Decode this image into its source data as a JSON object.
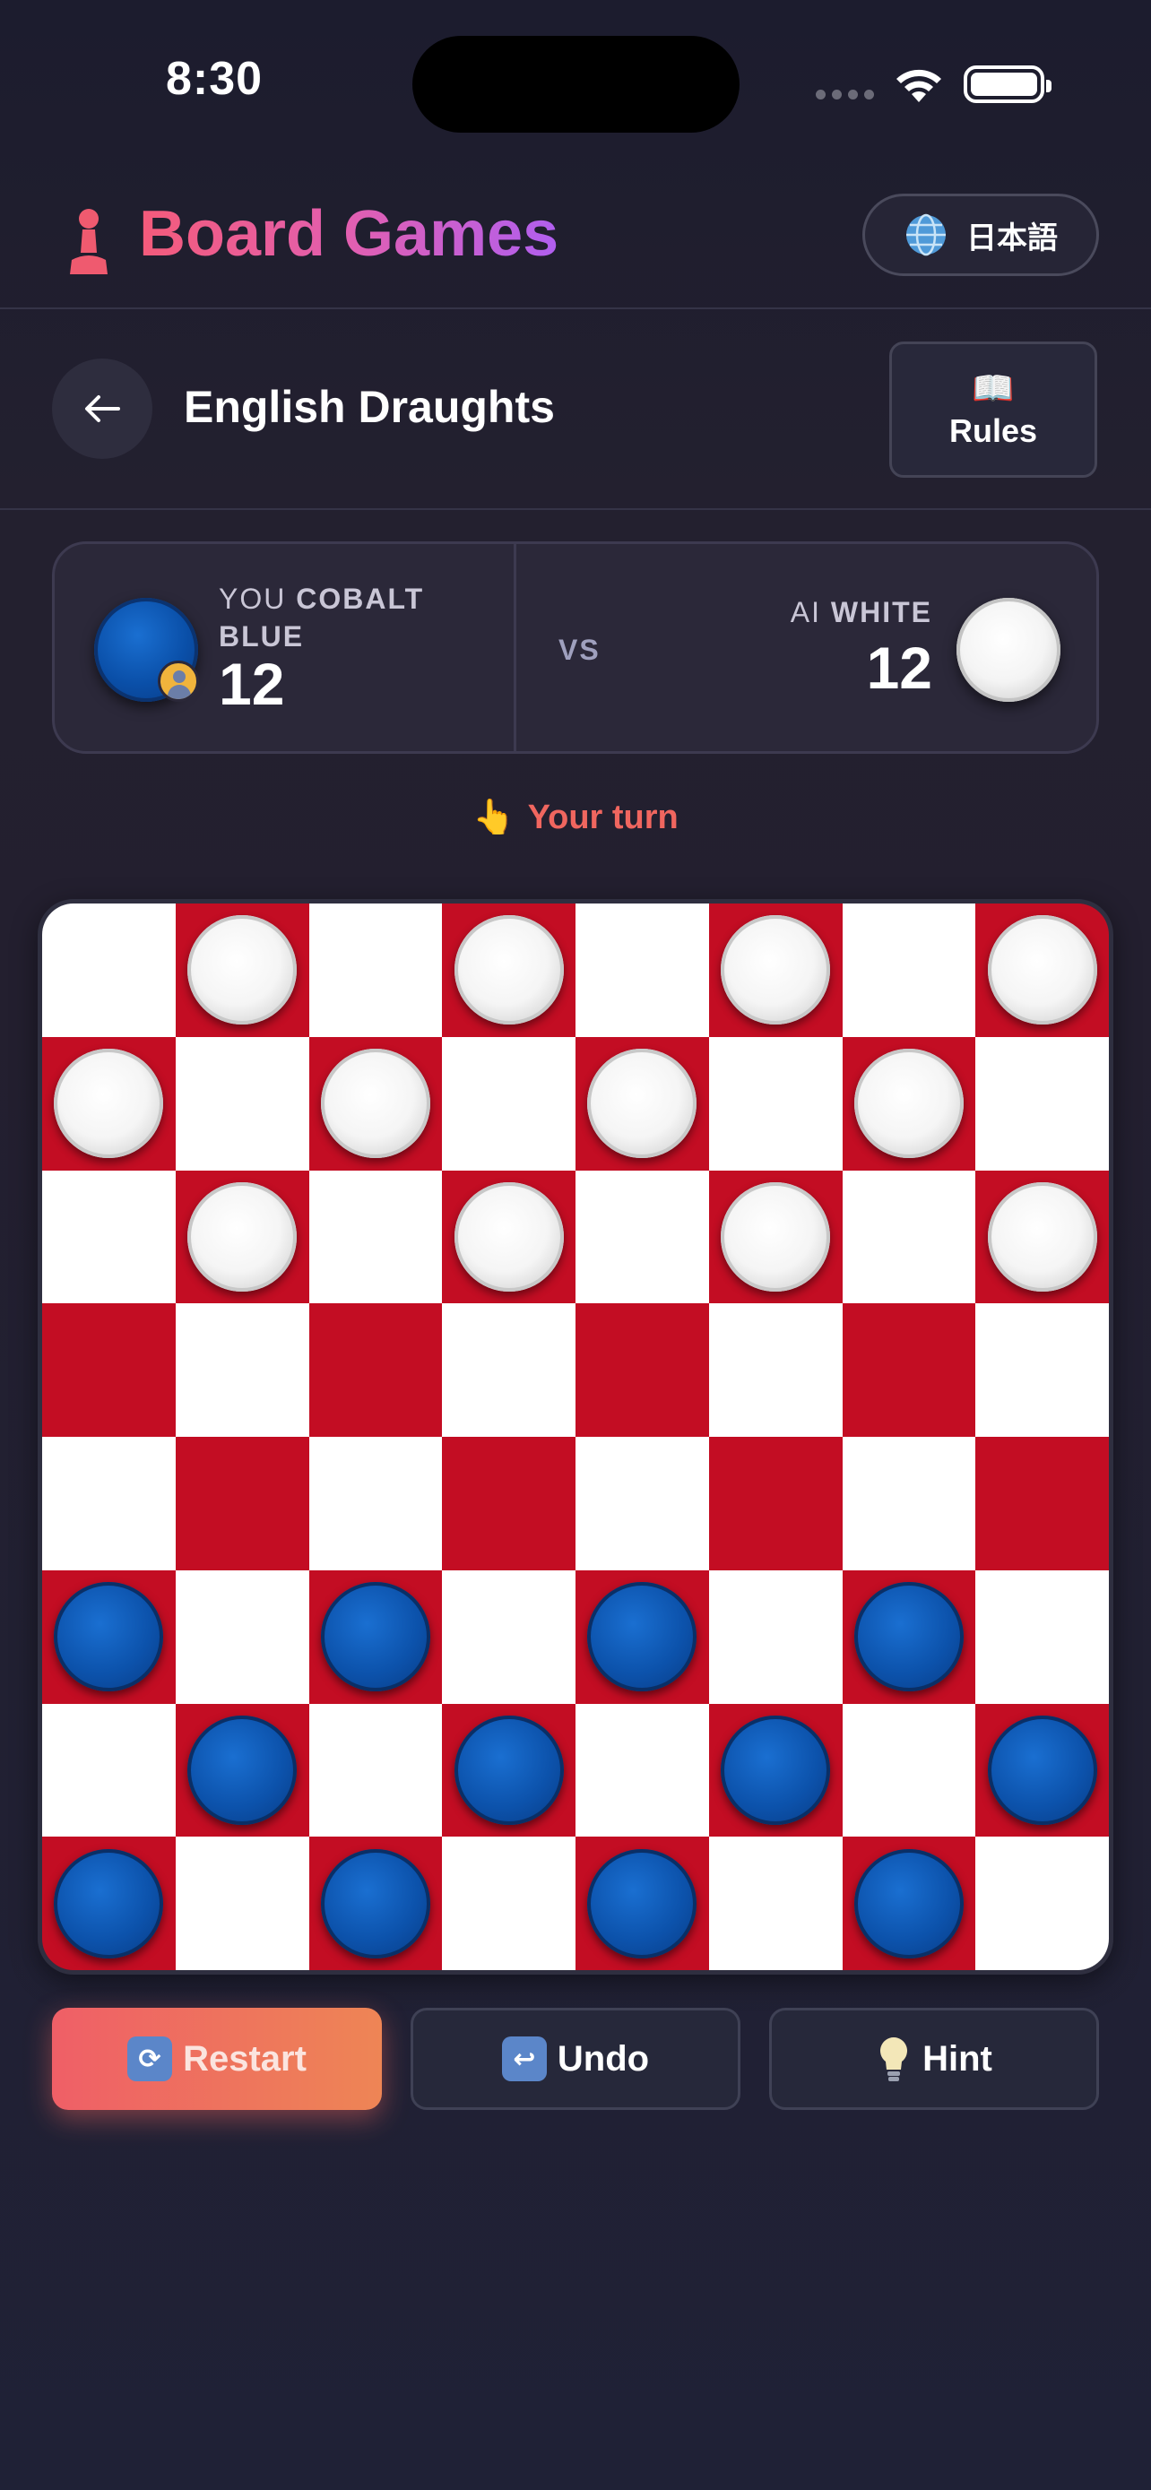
{
  "status_bar": {
    "time": "8:30"
  },
  "header": {
    "app_title": "Board Games",
    "language_button": "日本語"
  },
  "game": {
    "title": "English Draughts",
    "rules_label": "Rules"
  },
  "players": {
    "you": {
      "role": "YOU",
      "color_name": "COBALT BLUE",
      "pieces": "12"
    },
    "vs_label": "VS",
    "ai": {
      "role": "AI",
      "color_name": "WHITE",
      "pieces": "12"
    }
  },
  "turn_text": "Your turn",
  "board": {
    "size": 8,
    "light_color": "#ffffff",
    "dark_color": "#c30d23",
    "rows": [
      ". W . W . W . W",
      "W . W . W . W .",
      ". W . W . W . W",
      ". . . . . . . .",
      ". . . . . . . .",
      "B . B . B . B .",
      ". B . B . B . B",
      "B . B . B . B ."
    ]
  },
  "actions": {
    "restart_label": "Restart",
    "undo_label": "Undo",
    "hint_label": "Hint"
  },
  "colors": {
    "accent": "#f0665f",
    "blue_piece": "#0c52ab",
    "white_piece": "#f5f5f5"
  }
}
